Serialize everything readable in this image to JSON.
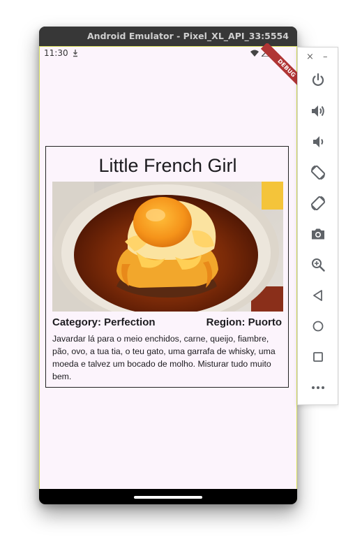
{
  "emulator": {
    "window_title": "Android Emulator - Pixel_XL_API_33:5554"
  },
  "status_bar": {
    "time": "11:30",
    "debug_banner": "DEBUG"
  },
  "recipe": {
    "title": "Little French Girl",
    "category": "Category: Perfection",
    "region": "Region: Puorto",
    "description": "Javardar lá para o meio enchidos, carne, queijo, fiambre, pão, ovo, a tua tia, o teu gato, uma garrafa de whisky, uma moeda e talvez um bocado de molho. Misturar tudo muito bem."
  },
  "toolbar": {
    "close_glyph": "×",
    "minimize_glyph": "–",
    "buttons": [
      {
        "icon": "power-icon"
      },
      {
        "icon": "volume-up-icon"
      },
      {
        "icon": "volume-down-icon"
      },
      {
        "icon": "rotate-left-icon"
      },
      {
        "icon": "rotate-right-icon"
      },
      {
        "icon": "camera-icon"
      },
      {
        "icon": "zoom-icon"
      },
      {
        "icon": "back-icon"
      },
      {
        "icon": "home-icon"
      },
      {
        "icon": "overview-icon"
      },
      {
        "icon": "more-icon"
      }
    ]
  },
  "colors": {
    "screen_background": "#fcf4fc",
    "title_bar": "#373737",
    "debug_ribbon": "#b03535",
    "toolbar_icon": "#5f6368"
  }
}
